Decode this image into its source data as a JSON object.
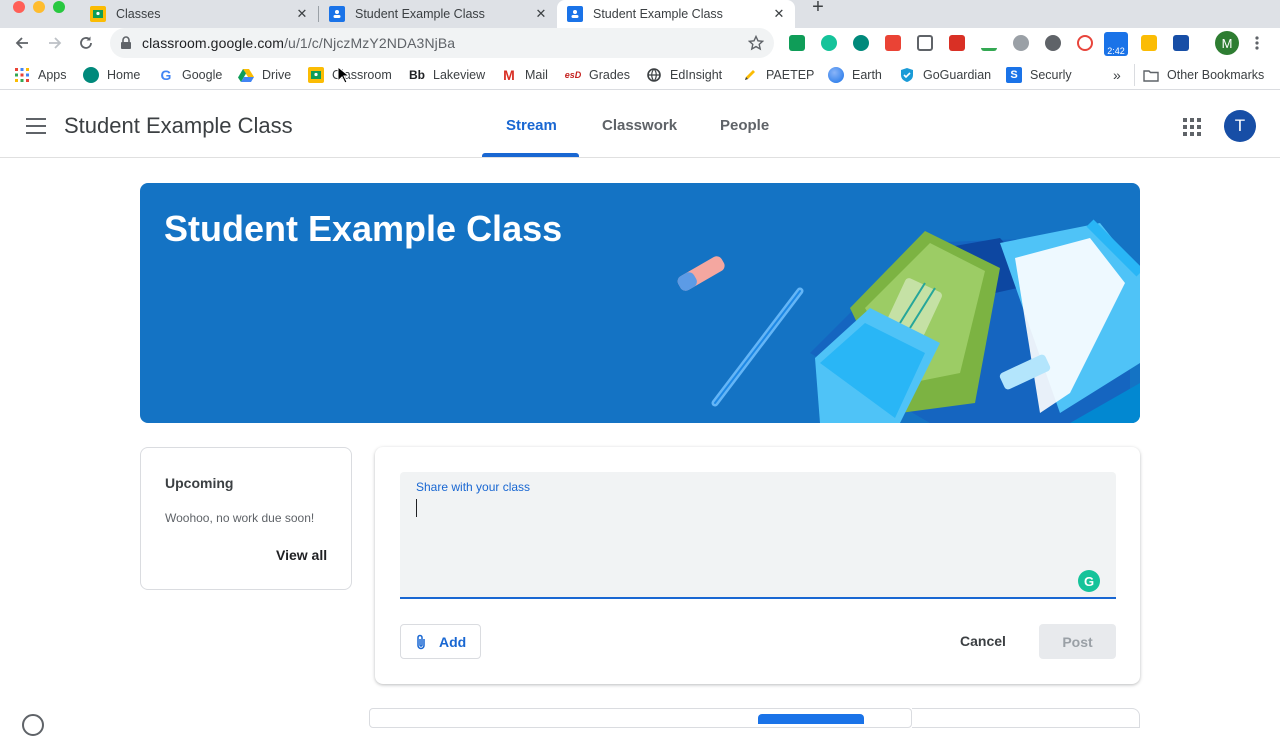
{
  "browser": {
    "tabs": [
      {
        "title": "Classes",
        "favicon": "classroom-icon",
        "active": false
      },
      {
        "title": "Student Example Class",
        "favicon": "classroom-people-icon",
        "active": false
      },
      {
        "title": "Student Example Class",
        "favicon": "classroom-people-icon",
        "active": true
      }
    ],
    "close_glyph": "✕",
    "new_tab_glyph": "+",
    "url_host": "classroom.google.com",
    "url_path": "/u/1/c/NjczMzY2NDA3NjBa",
    "extension_badge": "2:42",
    "profile_initial": "M"
  },
  "bookmarks": {
    "items": [
      {
        "label": "Apps",
        "icon": "apps-grid-icon"
      },
      {
        "label": "Home",
        "icon": "home-circle-icon"
      },
      {
        "label": "Google",
        "icon": "google-icon"
      },
      {
        "label": "Drive",
        "icon": "drive-icon"
      },
      {
        "label": "Classroom",
        "icon": "classroom-icon"
      },
      {
        "label": "Lakeview",
        "icon": "blackboard-icon",
        "icon_text": "Bb"
      },
      {
        "label": "Mail",
        "icon": "gmail-icon",
        "icon_text": "M"
      },
      {
        "label": "Grades",
        "icon": "esd-icon",
        "icon_text": "esD"
      },
      {
        "label": "EdInsight",
        "icon": "globe-icon"
      },
      {
        "label": "PAETEP",
        "icon": "pencil-icon"
      },
      {
        "label": "Earth",
        "icon": "earth-icon"
      },
      {
        "label": "GoGuardian",
        "icon": "goguardian-shield-icon"
      },
      {
        "label": "Securly",
        "icon": "securly-icon",
        "icon_text": "S"
      }
    ],
    "overflow_glyph": "»",
    "other_label": "Other Bookmarks"
  },
  "header": {
    "class_title": "Student Example Class",
    "tabs": [
      {
        "label": "Stream",
        "active": true
      },
      {
        "label": "Classwork",
        "active": false
      },
      {
        "label": "People",
        "active": false
      }
    ],
    "avatar_initial": "T"
  },
  "banner": {
    "title": "Student Example Class"
  },
  "upcoming": {
    "heading": "Upcoming",
    "message": "Woohoo, no work due soon!",
    "view_all": "View all"
  },
  "share": {
    "label": "Share with your class",
    "value": "",
    "add_label": "Add",
    "cancel_label": "Cancel",
    "post_label": "Post"
  },
  "colors": {
    "accent": "#1967d2",
    "banner": "#1473c4",
    "grammarly": "#15c39a"
  }
}
